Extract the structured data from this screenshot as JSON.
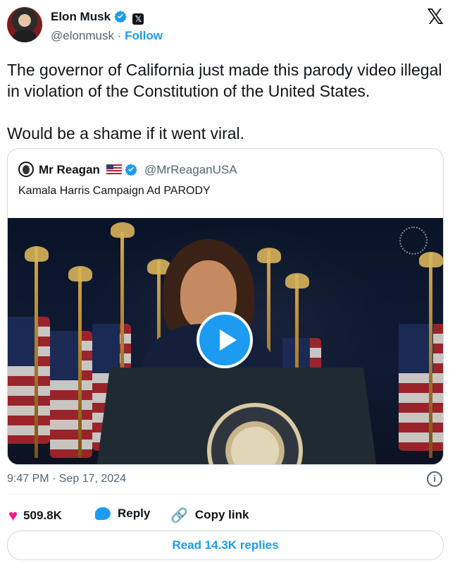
{
  "author": {
    "name": "Elon Musk",
    "handle": "@elonmusk",
    "separator": "·",
    "follow_label": "Follow",
    "x_badge": "𝕏",
    "platform_logo": "𝕏"
  },
  "tweet": {
    "paragraphs": [
      "The governor of California just made this parody video illegal in violation of the Constitution of the United States.",
      "Would be a shame if it went viral."
    ]
  },
  "quote": {
    "name": "Mr Reagan",
    "handle": "@MrReaganUSA",
    "text": "Kamala Harris Campaign Ad PARODY"
  },
  "meta": {
    "timestamp": "9:47 PM · Sep 17, 2024",
    "info_icon_glyph": "i"
  },
  "actions": {
    "likes": "509.8K",
    "reply_label": "Reply",
    "copy_label": "Copy link",
    "read_replies": "Read 14.3K replies"
  },
  "colors": {
    "accent": "#1d9bf0",
    "like": "#f91880",
    "muted": "#536471",
    "text": "#0f1419"
  },
  "icons": {
    "verified": "verified-badge-icon",
    "x_logo": "x-logo-icon",
    "heart": "heart-icon",
    "reply": "reply-bubble-icon",
    "link": "link-icon",
    "info": "info-icon",
    "play": "play-icon",
    "flag": "us-flag-icon"
  }
}
